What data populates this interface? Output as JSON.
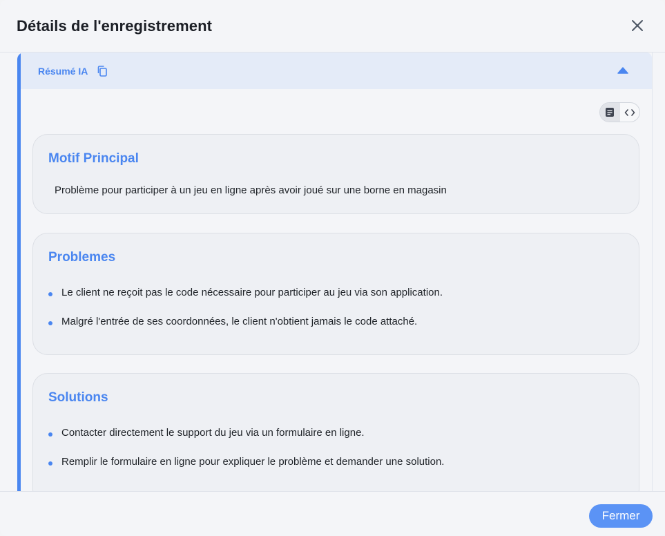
{
  "modal": {
    "title": "Détails de l'enregistrement",
    "close_icon": "close-icon"
  },
  "ai_summary": {
    "label": "Résumé IA",
    "copy_icon": "copy-icon",
    "collapse_icon": "caret-up-icon",
    "view_modes": [
      "document-icon",
      "code-icon"
    ],
    "active_view": "document-icon"
  },
  "sections": {
    "motif": {
      "title": "Motif Principal",
      "text": "Problème pour participer à un jeu en ligne après avoir joué sur une borne en magasin"
    },
    "problemes": {
      "title": "Problemes",
      "items": [
        "Le client ne reçoit pas le code nécessaire pour participer au jeu via son application.",
        "Malgré l'entrée de ses coordonnées, le client n'obtient jamais le code attaché."
      ]
    },
    "solutions": {
      "title": "Solutions",
      "items": [
        "Contacter directement le support du jeu via un formulaire en ligne.",
        "Remplir le formulaire en ligne pour expliquer le problème et demander une solution."
      ]
    }
  },
  "footer": {
    "close_label": "Fermer"
  },
  "colors": {
    "accent": "#4a86f0",
    "button": "#5b93f5",
    "panel_header": "#e4ebf8"
  }
}
